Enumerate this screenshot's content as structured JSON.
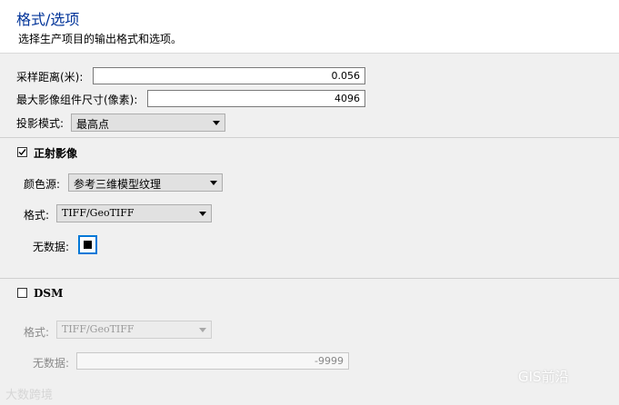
{
  "header": {
    "title": "格式/选项",
    "subtitle": "选择生产项目的输出格式和选项。"
  },
  "options": {
    "sampling_distance_label": "采样距离(米):",
    "sampling_distance_value": "0.056",
    "max_tile_label": "最大影像组件尺寸(像素):",
    "max_tile_value": "4096",
    "projection_label": "投影模式:",
    "projection_value": "最高点"
  },
  "ortho": {
    "enabled": true,
    "label": "正射影像",
    "color_source_label": "颜色源:",
    "color_source_value": "参考三维模型纹理",
    "format_label": "格式:",
    "format_value": "TIFF/GeoTIFF",
    "nodata_label": "无数据:",
    "nodata_color": "#000000"
  },
  "dsm": {
    "enabled": false,
    "label": "DSM",
    "format_label": "格式:",
    "format_value": "TIFF/GeoTIFF",
    "nodata_label": "无数据:",
    "nodata_value": "-9999"
  },
  "watermarks": {
    "left": "大数跨境",
    "right": "GIS前沿"
  },
  "colors": {
    "title": "#003399",
    "focus_border": "#0078d7",
    "background": "#f0f0f0"
  }
}
